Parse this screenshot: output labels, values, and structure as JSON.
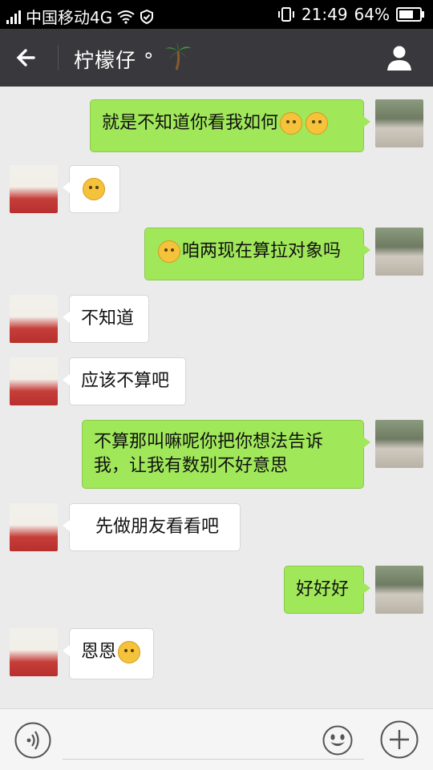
{
  "status_bar": {
    "carrier": "中国移动4G",
    "time": "21:49",
    "battery": "64%"
  },
  "header": {
    "title": "柠檬仔 °",
    "back_icon": "arrow-left-icon",
    "profile_icon": "person-icon",
    "title_emoji": "palm-tree-icon"
  },
  "messages": [
    {
      "side": "me",
      "text": "就是不知道你看我如何",
      "emojis": [
        "sweat-face-emoji",
        "sweat-face-emoji"
      ]
    },
    {
      "side": "them",
      "text": "",
      "emojis": [
        "surprised-face-emoji"
      ]
    },
    {
      "side": "me",
      "text": "咱两现在算拉对象吗",
      "emojis": [
        "thinking-face-emoji"
      ]
    },
    {
      "side": "them",
      "text": "不知道"
    },
    {
      "side": "them",
      "text": "应该不算吧"
    },
    {
      "side": "me",
      "text": "不算那叫嘛呢你把你想法告诉我，让我有数别不好意思"
    },
    {
      "side": "them",
      "text": "先做朋友看看吧"
    },
    {
      "side": "me",
      "text": "好好好"
    },
    {
      "side": "them",
      "text": "恩恩",
      "emojis": [
        "grin-face-emoji"
      ]
    }
  ],
  "input": {
    "placeholder": "",
    "voice_icon": "voice-icon",
    "emoji_icon": "smiley-icon",
    "plus_icon": "plus-icon"
  },
  "colors": {
    "my_bubble": "#a0e75a",
    "their_bubble": "#ffffff",
    "header_bg": "#39393d",
    "chat_bg": "#ebebeb"
  }
}
